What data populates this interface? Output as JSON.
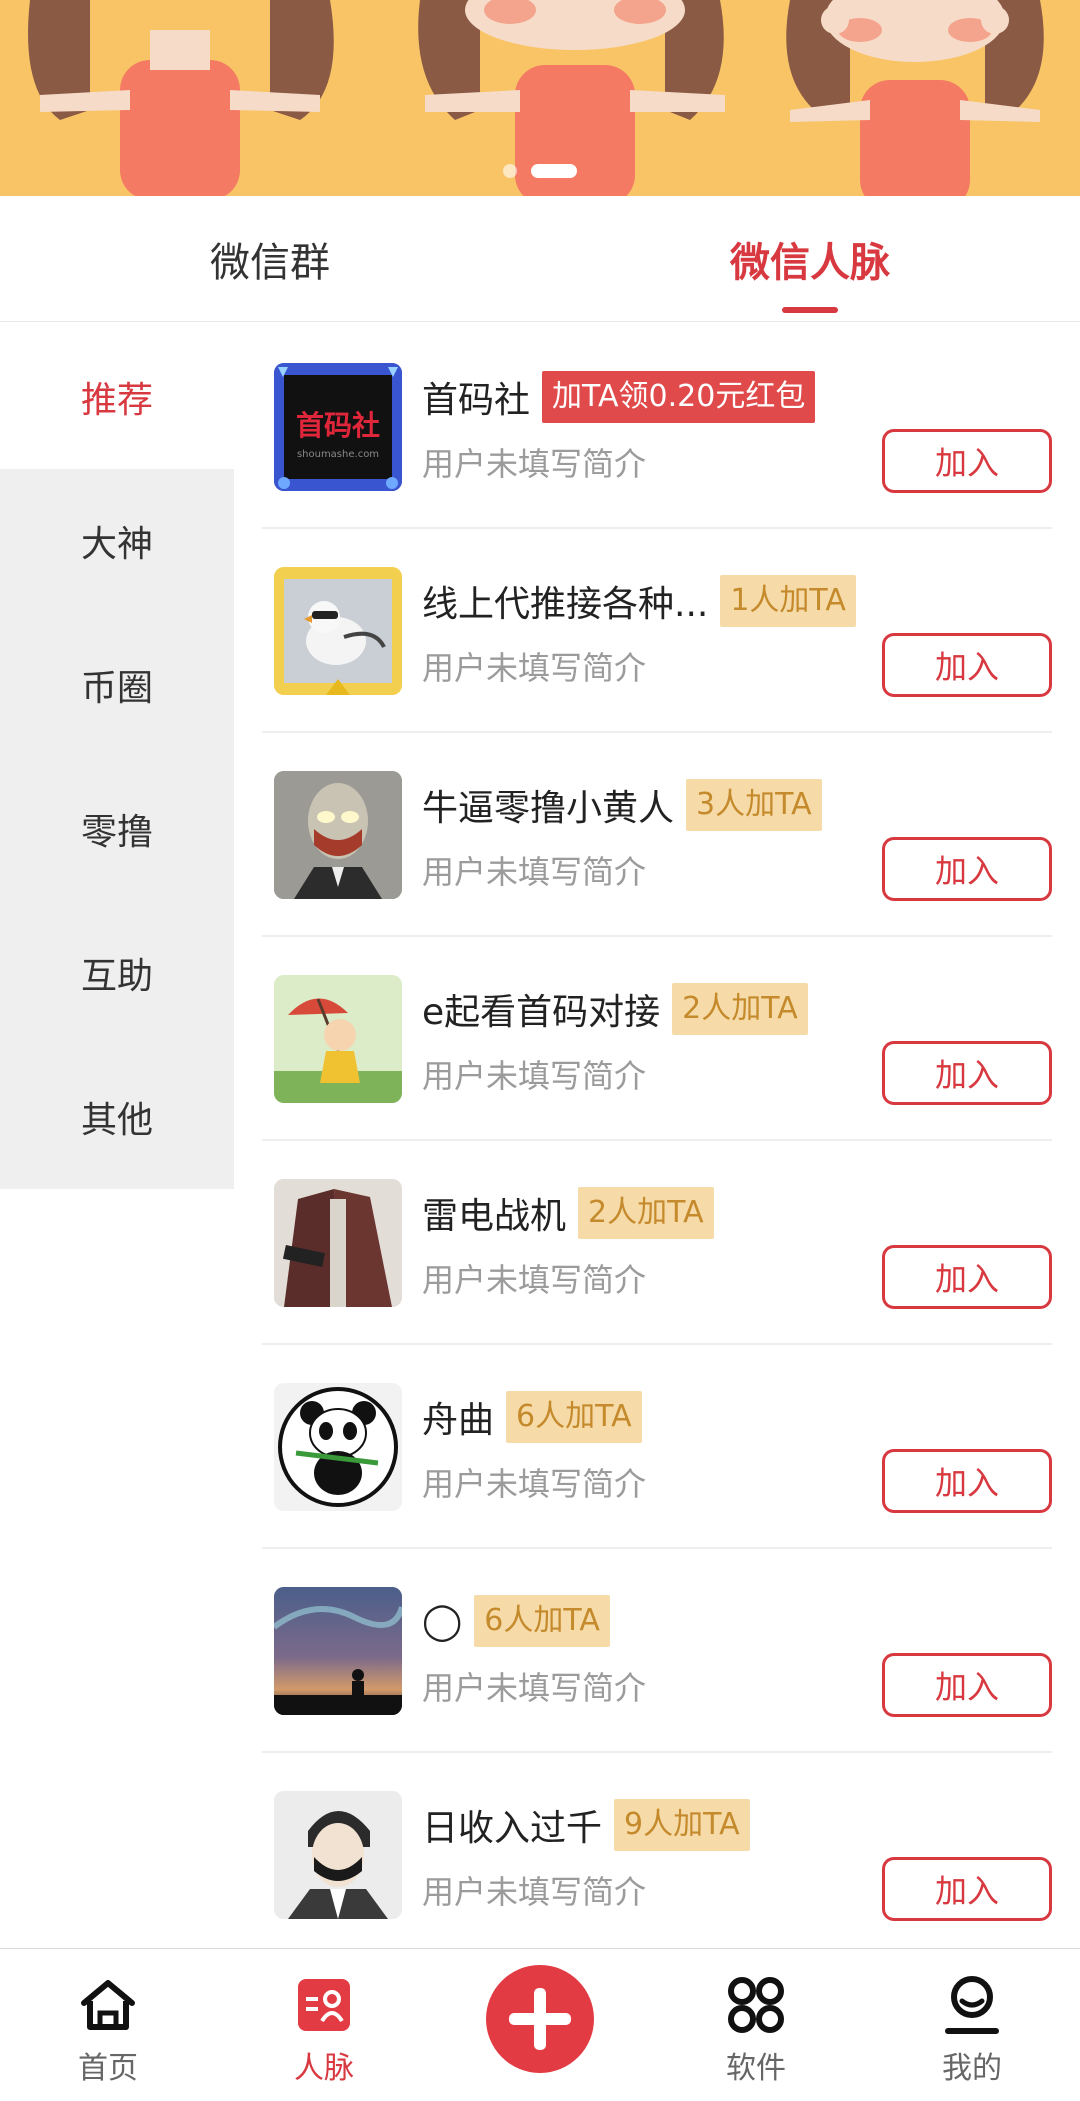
{
  "tabs": [
    {
      "label": "微信群",
      "active": false
    },
    {
      "label": "微信人脉",
      "active": true
    }
  ],
  "categories": [
    {
      "label": "推荐",
      "active": true
    },
    {
      "label": "大神",
      "active": false
    },
    {
      "label": "币圈",
      "active": false
    },
    {
      "label": "零撸",
      "active": false
    },
    {
      "label": "互助",
      "active": false
    },
    {
      "label": "其他",
      "active": false
    }
  ],
  "contacts": [
    {
      "name": "首码社",
      "badge": "加TA领0.20元红包",
      "desc": "用户未填写简介",
      "join": "加入",
      "avatar": "shoumashe-logo-avatar"
    },
    {
      "name": "线上代推接各种...",
      "badge": "1人加TA",
      "desc": "用户未填写简介",
      "join": "加入",
      "avatar": "bird-avatar"
    },
    {
      "name": "牛逼零撸小黄人",
      "badge": "3人加TA",
      "desc": "用户未填写简介",
      "join": "加入",
      "avatar": "ultraman-avatar"
    },
    {
      "name": "e起看首码对接",
      "badge": "2人加TA",
      "desc": "用户未填写简介",
      "join": "加入",
      "avatar": "umbrella-kid-avatar"
    },
    {
      "name": "雷电战机",
      "badge": "2人加TA",
      "desc": "用户未填写简介",
      "join": "加入",
      "avatar": "robe-man-avatar"
    },
    {
      "name": "舟曲",
      "badge": "6人加TA",
      "desc": "用户未填写简介",
      "join": "加入",
      "avatar": "panda-avatar"
    },
    {
      "name": "◯",
      "badge": "6人加TA",
      "desc": "用户未填写简介",
      "join": "加入",
      "avatar": "aurora-avatar"
    },
    {
      "name": "日收入过千",
      "badge": "9人加TA",
      "desc": "用户未填写简介",
      "join": "加入",
      "avatar": "masked-boy-avatar"
    }
  ],
  "bottom_nav": [
    {
      "label": "首页",
      "icon": "home-icon",
      "active": false
    },
    {
      "label": "人脉",
      "icon": "contacts-icon",
      "active": true
    },
    {
      "label": "",
      "icon": "plus-icon",
      "active": false
    },
    {
      "label": "软件",
      "icon": "apps-icon",
      "active": false
    },
    {
      "label": "我的",
      "icon": "profile-icon",
      "active": false
    }
  ],
  "colors": {
    "accent": "#d8383f",
    "badge_bg": "#f6dba9",
    "badge_text": "#c48a2c",
    "banner_bg": "#f8c466"
  }
}
